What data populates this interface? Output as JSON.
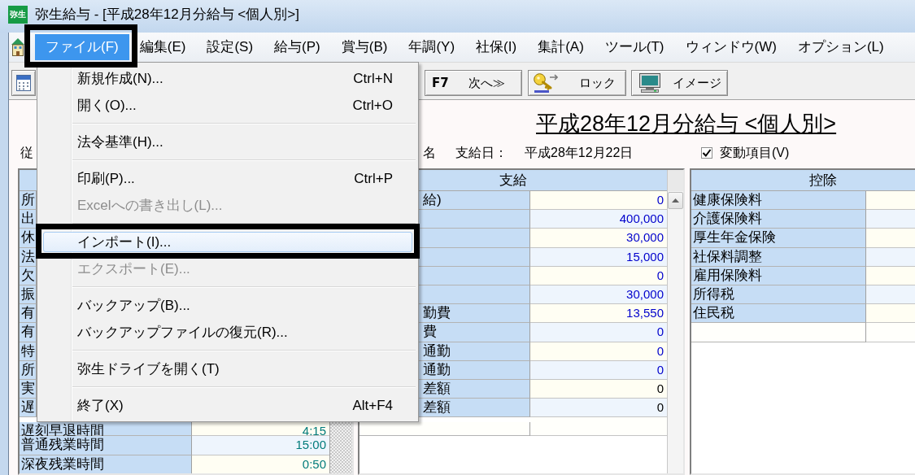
{
  "window": {
    "title": "弥生給与 - [平成28年12月分給与 <個人別>]",
    "icon_text": "弥生"
  },
  "menu_bar": {
    "items": [
      {
        "label": "ファイル(F)",
        "selected": true,
        "outlined": true
      },
      {
        "label": "編集(E)",
        "selected": false,
        "outlined": false
      },
      {
        "label": "設定(S)",
        "selected": false,
        "outlined": false
      },
      {
        "label": "給与(P)",
        "selected": false,
        "outlined": false
      },
      {
        "label": "賞与(B)",
        "selected": false,
        "outlined": false
      },
      {
        "label": "年調(Y)",
        "selected": false,
        "outlined": false
      },
      {
        "label": "社保(I)",
        "selected": false,
        "outlined": false
      },
      {
        "label": "集計(A)",
        "selected": false,
        "outlined": false
      },
      {
        "label": "ツール(T)",
        "selected": false,
        "outlined": false
      },
      {
        "label": "ウィンドウ(W)",
        "selected": false,
        "outlined": false
      },
      {
        "label": "オプション(L)",
        "selected": false,
        "outlined": false
      }
    ]
  },
  "file_menu": {
    "items": [
      {
        "kind": "item",
        "label": "新規作成(N)...",
        "shortcut": "Ctrl+N",
        "disabled": false,
        "selected": false,
        "outlined": false
      },
      {
        "kind": "item",
        "label": "開く(O)...",
        "shortcut": "Ctrl+O",
        "disabled": false,
        "selected": false,
        "outlined": false
      },
      {
        "kind": "separator"
      },
      {
        "kind": "item",
        "label": "法令基準(H)...",
        "disabled": false,
        "selected": false,
        "outlined": false
      },
      {
        "kind": "separator"
      },
      {
        "kind": "item",
        "label": "印刷(P)...",
        "shortcut": "Ctrl+P",
        "disabled": false,
        "selected": false,
        "outlined": false
      },
      {
        "kind": "item",
        "label": "Excelへの書き出し(L)...",
        "disabled": true,
        "selected": false,
        "outlined": false
      },
      {
        "kind": "separator"
      },
      {
        "kind": "item",
        "label": "インポート(I)...",
        "disabled": false,
        "selected": true,
        "outlined": true
      },
      {
        "kind": "item",
        "label": "エクスポート(E)...",
        "disabled": true,
        "selected": false,
        "outlined": false
      },
      {
        "kind": "separator"
      },
      {
        "kind": "item",
        "label": "バックアップ(B)...",
        "disabled": false,
        "selected": false,
        "outlined": false
      },
      {
        "kind": "item",
        "label": "バックアップファイルの復元(R)...",
        "disabled": false,
        "selected": false,
        "outlined": false
      },
      {
        "kind": "separator"
      },
      {
        "kind": "item",
        "label": "弥生ドライブを開く(T)",
        "disabled": false,
        "selected": false,
        "outlined": false
      },
      {
        "kind": "separator"
      },
      {
        "kind": "item",
        "label": "終了(X)",
        "shortcut": "Alt+F4",
        "disabled": false,
        "selected": false,
        "outlined": false
      }
    ]
  },
  "toolbar": {
    "buttons": [
      {
        "kind": "icon"
      },
      {
        "kind": "key",
        "key": "F7",
        "label": "次へ≫"
      },
      {
        "kind": "labeled",
        "label": "ロック"
      },
      {
        "kind": "labeled",
        "label": "イメージ"
      }
    ]
  },
  "report": {
    "title": "平成28年12月分給与 <個人別>",
    "employee_label": "従",
    "name_label": "名",
    "pay_date_label": "支給日：",
    "pay_date": "平成28年12月22日",
    "variable_items": {
      "label": "変動項目(V)",
      "checked": true
    }
  },
  "tables": [
    {
      "rows": [
        {
          "label": "所"
        },
        {
          "label": "出"
        },
        {
          "label": "休"
        },
        {
          "label": "法"
        },
        {
          "label": "欠"
        },
        {
          "label": "振"
        },
        {
          "label": "有"
        },
        {
          "label": "有"
        },
        {
          "label": "特"
        },
        {
          "label": "所"
        },
        {
          "label": "実"
        },
        {
          "label": "遅"
        },
        {
          "label": "遅刻早退時間",
          "value": "4:15",
          "color": "#007b7b"
        },
        {
          "label": "普通残業時間",
          "value": "15:00",
          "color": "#007b7b"
        },
        {
          "label": "深夜残業時間",
          "value": "0:50",
          "color": "#007b7b"
        }
      ]
    },
    {
      "header": "支給",
      "rows": [
        {
          "label": "給)",
          "value": "0",
          "color": "#0000cc"
        },
        {
          "value": "400,000",
          "color": "#0000cc"
        },
        {
          "value": "30,000",
          "color": "#0000cc"
        },
        {
          "value": "15,000",
          "color": "#0000cc"
        },
        {
          "value": "0",
          "color": "#0000cc"
        },
        {
          "value": "30,000",
          "color": "#0000cc"
        },
        {
          "label": "勤費",
          "value": "13,550",
          "color": "#0000cc"
        },
        {
          "label": "費",
          "value": "0",
          "color": "#0000cc"
        },
        {
          "label": "通勤",
          "value": "0",
          "color": "#0000cc"
        },
        {
          "label": "通勤",
          "value": "0",
          "color": "#0000cc"
        },
        {
          "label": "差額",
          "value": "0",
          "color": "#000000"
        },
        {
          "label": "差額",
          "value": "0",
          "color": "#000000"
        }
      ]
    },
    {
      "header": "控除",
      "rows": [
        {
          "label": "健康保険料"
        },
        {
          "label": "介護保険料"
        },
        {
          "label": "厚生年金保険"
        },
        {
          "label": "社保料調整"
        },
        {
          "label": "雇用保険料"
        },
        {
          "label": "所得税"
        },
        {
          "label": "住民税"
        }
      ]
    }
  ]
}
